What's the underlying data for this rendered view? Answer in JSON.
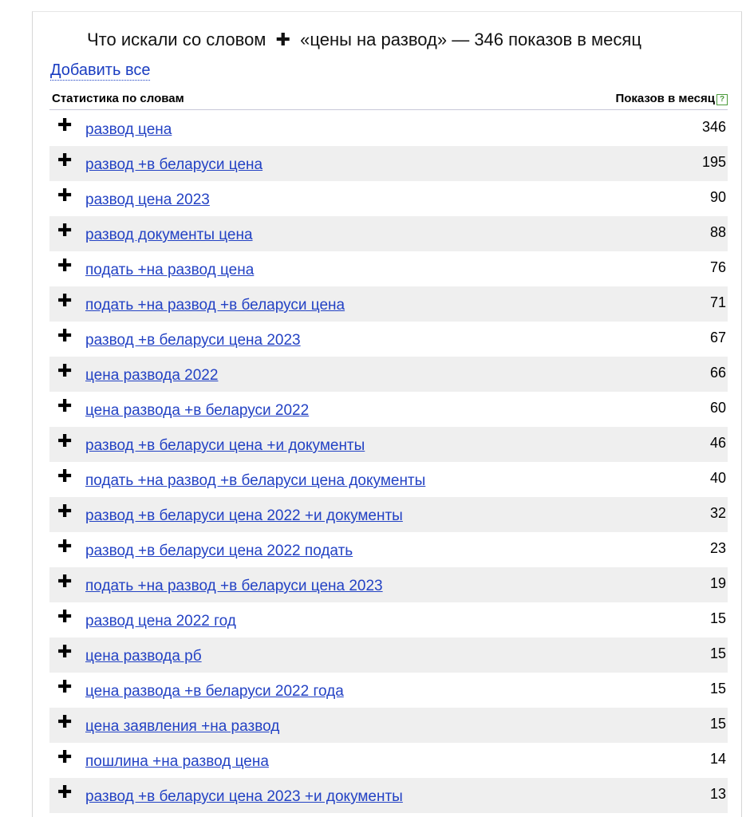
{
  "title": {
    "prefix": "Что искали со словом",
    "plus": "✚",
    "suffix": "«цены на развод» — 346 показов в месяц"
  },
  "add_all_label": "Добавить все",
  "table": {
    "col_words": "Статистика по словам",
    "col_count": "Показов в месяц",
    "help_icon": "?",
    "rows": [
      {
        "phrase": "развод цена",
        "count": "346"
      },
      {
        "phrase": "развод +в беларуси цена",
        "count": "195"
      },
      {
        "phrase": "развод цена 2023",
        "count": "90"
      },
      {
        "phrase": "развод документы цена",
        "count": "88"
      },
      {
        "phrase": "подать +на развод цена",
        "count": "76"
      },
      {
        "phrase": "подать +на развод +в беларуси цена",
        "count": "71"
      },
      {
        "phrase": "развод +в беларуси цена 2023",
        "count": "67"
      },
      {
        "phrase": "цена развода 2022",
        "count": "66"
      },
      {
        "phrase": "цена развода +в беларуси 2022",
        "count": "60"
      },
      {
        "phrase": "развод +в беларуси цена +и документы",
        "count": "46"
      },
      {
        "phrase": "подать +на развод +в беларуси цена документы",
        "count": "40"
      },
      {
        "phrase": "развод +в беларуси цена 2022 +и документы",
        "count": "32"
      },
      {
        "phrase": "развод +в беларуси цена 2022 подать",
        "count": "23"
      },
      {
        "phrase": "подать +на развод +в беларуси цена 2023",
        "count": "19"
      },
      {
        "phrase": "развод цена 2022 год",
        "count": "15"
      },
      {
        "phrase": "цена развода рб",
        "count": "15"
      },
      {
        "phrase": "цена развода +в беларуси 2022 года",
        "count": "15"
      },
      {
        "phrase": "цена заявления +на развод",
        "count": "15"
      },
      {
        "phrase": "пошлина +на развод цена",
        "count": "14"
      },
      {
        "phrase": "развод +в беларуси цена 2023 +и документы",
        "count": "13"
      }
    ]
  }
}
